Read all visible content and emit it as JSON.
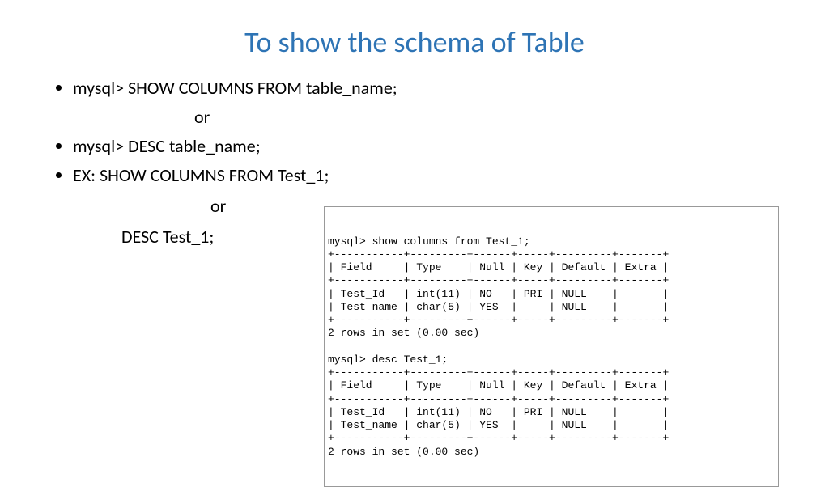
{
  "title": "To show the schema of Table",
  "bullets": {
    "b1": "mysql> SHOW COLUMNS FROM table_name;",
    "or1": "or",
    "b2": "mysql> DESC table_name;",
    "b3": "EX: SHOW COLUMNS FROM Test_1;",
    "or2": "or",
    "b4": "DESC Test_1;"
  },
  "terminal": "mysql> show columns from Test_1;\n+-----------+---------+------+-----+---------+-------+\n| Field     | Type    | Null | Key | Default | Extra |\n+-----------+---------+------+-----+---------+-------+\n| Test_Id   | int(11) | NO   | PRI | NULL    |       |\n| Test_name | char(5) | YES  |     | NULL    |       |\n+-----------+---------+------+-----+---------+-------+\n2 rows in set (0.00 sec)\n\nmysql> desc Test_1;\n+-----------+---------+------+-----+---------+-------+\n| Field     | Type    | Null | Key | Default | Extra |\n+-----------+---------+------+-----+---------+-------+\n| Test_Id   | int(11) | NO   | PRI | NULL    |       |\n| Test_name | char(5) | YES  |     | NULL    |       |\n+-----------+---------+------+-----+---------+-------+\n2 rows in set (0.00 sec)"
}
